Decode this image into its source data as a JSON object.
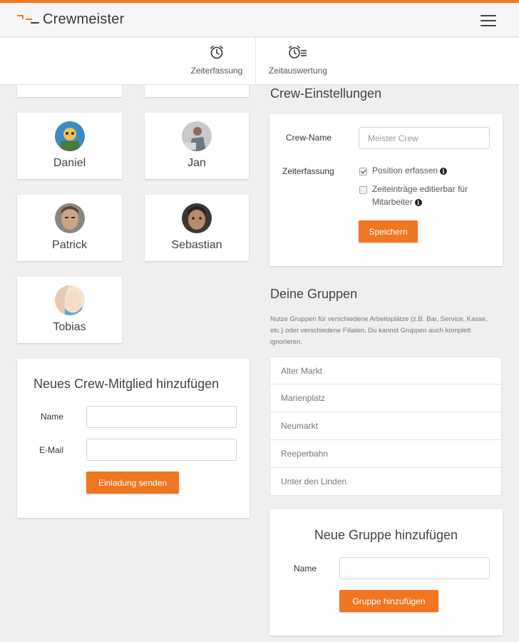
{
  "brand": {
    "name": "Crewmeister",
    "accent": "#f07622"
  },
  "tabs": [
    {
      "label": "Zeiterfassung",
      "icon": "alarm-clock-icon"
    },
    {
      "label": "Zeitauswertung",
      "icon": "clock-list-icon"
    }
  ],
  "members": [
    {
      "name": "Daniel"
    },
    {
      "name": "Jan"
    },
    {
      "name": "Patrick"
    },
    {
      "name": "Sebastian"
    },
    {
      "name": "Tobias"
    }
  ],
  "add_member": {
    "title": "Neues Crew-Mitglied hinzufügen",
    "name_label": "Name",
    "email_label": "E-Mail",
    "name_value": "",
    "email_value": "",
    "submit_label": "Einladung senden"
  },
  "crew_settings": {
    "title": "Crew-Einstellungen",
    "crew_name_label": "Crew-Name",
    "crew_name_placeholder": "Meister Crew",
    "time_tracking_label": "Zeiterfassung",
    "options": [
      {
        "label": "Position erfassen",
        "checked": true
      },
      {
        "label": "Zeiteinträge editierbar für Mitarbeiter",
        "checked": false
      }
    ],
    "save_label": "Speichern"
  },
  "groups": {
    "title": "Deine Gruppen",
    "description": "Nutze Gruppen für verschiedene Arbeitsplätze (z.B. Bar, Service, Kasse, etc.) oder verschiedene Filialen. Du kannst Gruppen auch komplett ignorieren.",
    "items": [
      "Alter Markt",
      "Marienplatz",
      "Neumarkt",
      "Reeperbahn",
      "Unter den Linden"
    ]
  },
  "add_group": {
    "title": "Neue Gruppe hinzufügen",
    "name_label": "Name",
    "name_value": "",
    "submit_label": "Gruppe hinzufügen"
  }
}
